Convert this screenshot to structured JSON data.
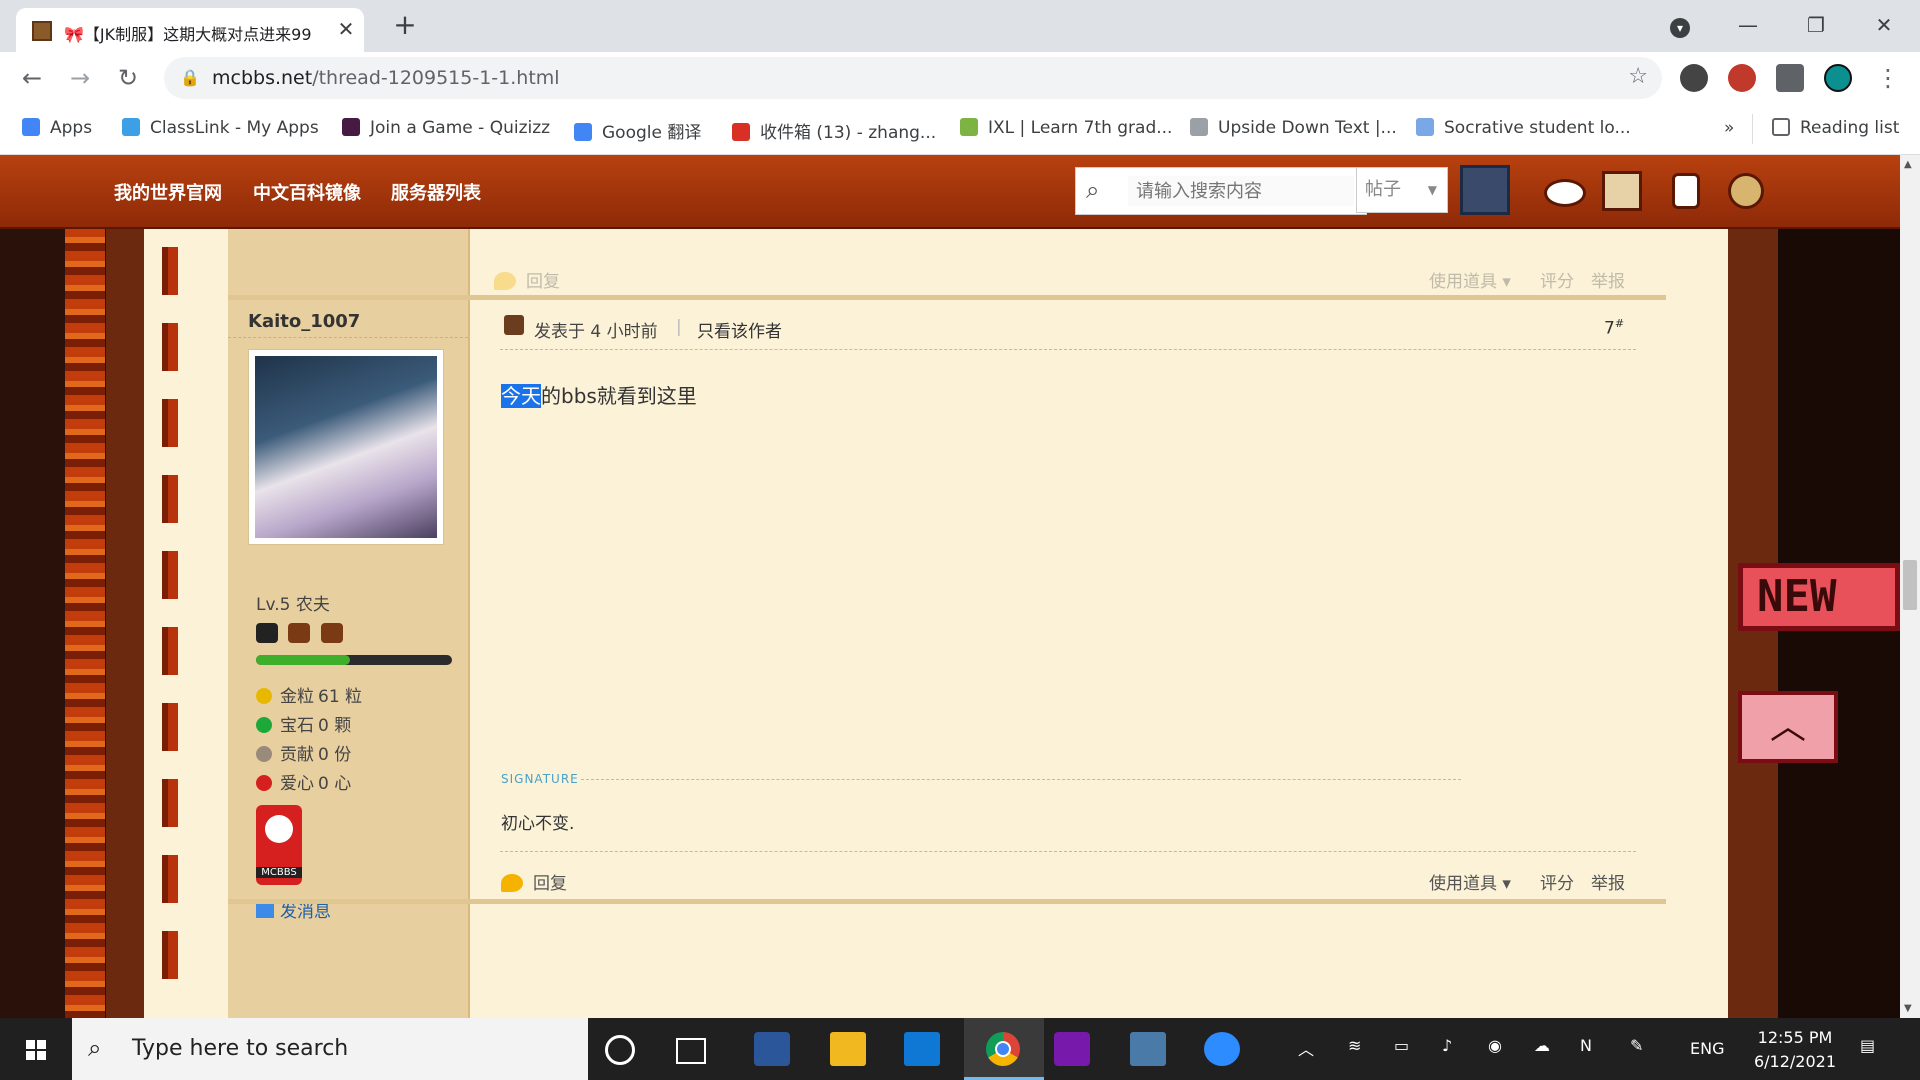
{
  "browser": {
    "tab_title": "🎀【JK制服】这期大概对点进来99",
    "url_host": "mcbbs.net",
    "url_path": "/thread-1209515-1-1.html",
    "reading_list": "Reading list",
    "more_bookmarks": "»",
    "bookmarks": [
      {
        "label": "Apps",
        "icon": "apps-grid-icon",
        "color": "#4285f4"
      },
      {
        "label": "ClassLink - My Apps",
        "icon": "classlink-icon",
        "color": "#3ba0e6"
      },
      {
        "label": "Join a Game - Quizizz",
        "icon": "quizizz-icon",
        "color": "#461a42"
      },
      {
        "label": "Google 翻译",
        "icon": "google-translate-icon",
        "color": "#4285f4"
      },
      {
        "label": "收件箱 (13) - zhang...",
        "icon": "gmail-icon",
        "color": "#d93025"
      },
      {
        "label": "IXL | Learn 7th grad...",
        "icon": "ixl-icon",
        "color": "#7cb342"
      },
      {
        "label": "Upside Down Text |...",
        "icon": "page-icon",
        "color": "#9aa0a6"
      },
      {
        "label": "Socrative student lo...",
        "icon": "socrative-icon",
        "color": "#7aa7e6"
      }
    ]
  },
  "site": {
    "nav": [
      "我的世界官网",
      "中文百科镜像",
      "服务器列表"
    ],
    "search_placeholder": "请输入搜索内容",
    "search_type": "帖子"
  },
  "post_actions": {
    "reply": "回复",
    "use_item": "使用道具",
    "rate": "评分",
    "report": "举报"
  },
  "post": {
    "author": "Kaito_1007",
    "level": "Lv.5 农夫",
    "stats": [
      {
        "label": "金粒",
        "value": "61 粒",
        "color": "#e8b800"
      },
      {
        "label": "宝石",
        "value": "0 颗",
        "color": "#1fa83a"
      },
      {
        "label": "贡献",
        "value": "0 份",
        "color": "#9a8a7a"
      },
      {
        "label": "爱心",
        "value": "0 心",
        "color": "#d62020"
      }
    ],
    "badge": "MCBBS",
    "send_message": "发消息",
    "posted": "发表于 4 小时前",
    "only_author": "只看该作者",
    "floor": "7",
    "floor_sup": "#",
    "body_highlighted": "今天",
    "body_rest": "的bbs就看到这里",
    "signature_label": "SIGNATURE",
    "signature": "初心不变."
  },
  "side_badges": [
    "NEW"
  ],
  "taskbar": {
    "search_placeholder": "Type here to search",
    "language": "ENG",
    "time": "12:55 PM",
    "date": "6/12/2021"
  }
}
